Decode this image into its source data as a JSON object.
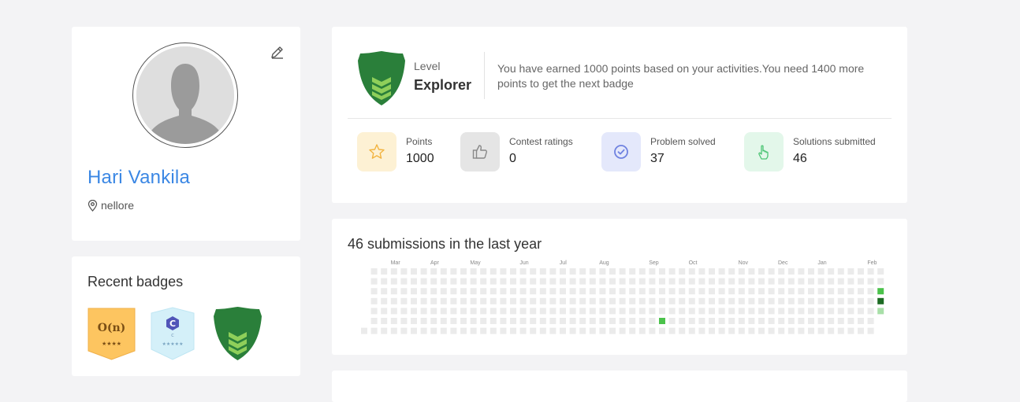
{
  "profile": {
    "name": "Hari Vankila",
    "location": "nellore",
    "edit_icon": "pencil-icon",
    "avatar_icon": "user-silhouette-icon"
  },
  "recent_badges": {
    "title": "Recent badges",
    "badges": [
      {
        "name": "big-o-badge",
        "symbol": "O(n)",
        "stars": "★★★★",
        "color": "#fdc560"
      },
      {
        "name": "c-language-badge",
        "symbol": "C",
        "sub": "C",
        "stars": "★★★★★",
        "color": "#d4f0f9"
      },
      {
        "name": "explorer-level-badge",
        "color": "#2a7f3a"
      }
    ]
  },
  "level": {
    "label": "Level",
    "value": "Explorer",
    "message": "You have earned 1000 points based on your activities.You need 1400 more points to get the next badge"
  },
  "stats": [
    {
      "key": "points",
      "label": "Points",
      "value": "1000",
      "icon": "star-icon",
      "bg": "#fdf1d4",
      "fg": "#f2b33f"
    },
    {
      "key": "contest",
      "label": "Contest ratings",
      "value": "0",
      "icon": "thumbs-up-icon",
      "bg": "#e5e5e5",
      "fg": "#888888"
    },
    {
      "key": "solved",
      "label": "Problem solved",
      "value": "37",
      "icon": "check-circle-icon",
      "bg": "#e4e8fb",
      "fg": "#6f82e0"
    },
    {
      "key": "submitted",
      "label": "Solutions submitted",
      "value": "46",
      "icon": "pointer-hand-icon",
      "bg": "#e3f7ea",
      "fg": "#4cc474"
    }
  ],
  "submissions": {
    "title": "46 submissions in the last year",
    "months": [
      "Mar",
      "Apr",
      "May",
      "Jun",
      "Jul",
      "Aug",
      "Sep",
      "Oct",
      "Nov",
      "Dec",
      "Jan",
      "Feb"
    ],
    "active": [
      {
        "week": 30,
        "day": 5,
        "level": 2
      },
      {
        "week": 52,
        "day": 2,
        "level": 2
      },
      {
        "week": 52,
        "day": 3,
        "level": 3
      },
      {
        "week": 52,
        "day": 4,
        "level": 1
      }
    ],
    "colors": {
      "empty": "#ebebeb",
      "l1": "#a8dfa8",
      "l2": "#4bc24b",
      "l3": "#1c6b23"
    }
  }
}
